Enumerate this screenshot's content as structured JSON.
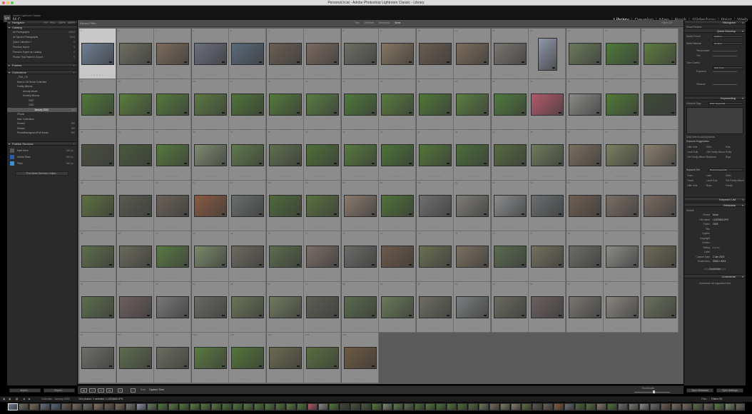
{
  "window": {
    "title": "Personal.lrcat - Adobe Photoshop Lightroom Classic - Library"
  },
  "identity": {
    "logo": "Lrc",
    "line1": "Adobe Lightroom Classic",
    "line2": "M C"
  },
  "modules": [
    "Library",
    "Develop",
    "Map",
    "Book",
    "Slideshow",
    "Print",
    "Web"
  ],
  "active_module": "Library",
  "left_panel": {
    "navigator": {
      "label": "Navigator",
      "zoom": [
        "FIT",
        "FILL",
        "100%",
        "400%"
      ]
    },
    "catalog": {
      "label": "Catalog",
      "items": [
        {
          "label": "All Photographs",
          "count": "25264"
        },
        {
          "label": "All Synced Photographs",
          "count": "5183"
        },
        {
          "label": "Quick Collection +",
          "count": "0"
        },
        {
          "label": "Previous Import",
          "count": "5"
        },
        {
          "label": "Previous Export as Catalog",
          "count": "0"
        },
        {
          "label": "Photos That Failed to Export",
          "count": "0"
        }
      ]
    },
    "folders": {
      "label": "Folders"
    },
    "collections": {
      "label": "Collections",
      "items": [
        {
          "label": "_TAG_CS",
          "count": ""
        },
        {
          "label": "Mom & Gill Smart Collection",
          "count": ""
        },
        {
          "label": "Family Albums",
          "count": ""
        },
        {
          "label": "Annual Album",
          "count": ""
        },
        {
          "label": "Monthly Albums",
          "count": ""
        },
        {
          "label": "2022",
          "count": ""
        },
        {
          "label": "2023",
          "count": ""
        },
        {
          "label": "January 2023",
          "count": "104"
        },
        {
          "label": "iPhone",
          "count": ""
        },
        {
          "label": "Misc Collections",
          "count": ""
        },
        {
          "label": "Shared",
          "count": "990"
        },
        {
          "label": "Shares",
          "count": "990"
        },
        {
          "label": "PhotosBackgroundFull Sessio",
          "count": "990"
        }
      ]
    },
    "publish": {
      "label": "Publish Services",
      "items": [
        {
          "label": "Hard Drive",
          "action": "Set Up..."
        },
        {
          "label": "Adobe Stock",
          "action": "Set Up..."
        },
        {
          "label": "Flickr",
          "action": "Set Up..."
        }
      ],
      "find_more": "Find More Services Online..."
    },
    "import_label": "Import...",
    "export_label": "Export..."
  },
  "grid": {
    "filter_title": "Library Filter :",
    "filter_tabs": [
      "Text",
      "Attribute",
      "Metadata",
      "None"
    ],
    "filters_off": "Filters Off",
    "photos": [
      {
        "n": "1",
        "c": "#6f7f95",
        "s": true
      },
      {
        "n": "2",
        "c": "#6e6e62"
      },
      {
        "n": "3",
        "c": "#7d6c5c"
      },
      {
        "n": "4",
        "c": "#6b6f7e"
      },
      {
        "n": "5",
        "c": "#5a6a7a"
      },
      {
        "n": "6",
        "c": "#6a5f55"
      },
      {
        "n": "7",
        "c": "#7a6a60"
      },
      {
        "n": "8",
        "c": "#6e6e66"
      },
      {
        "n": "9",
        "c": "#857560"
      },
      {
        "n": "10",
        "c": "#6a5c50"
      },
      {
        "n": "11",
        "c": "#7c6d5a"
      },
      {
        "n": "12",
        "c": "#7a7570"
      },
      {
        "n": "13",
        "c": "#8f96a8",
        "p": true
      },
      {
        "n": "14",
        "c": "#6a7a5a"
      },
      {
        "n": "15",
        "c": "#4e7a3a"
      },
      {
        "n": "16",
        "c": "#5c7c3e"
      },
      {
        "n": "17",
        "c": "#4f7a38"
      },
      {
        "n": "18",
        "c": "#5a7e3d"
      },
      {
        "n": "19",
        "c": "#557a3c"
      },
      {
        "n": "20",
        "c": "#5a7a40"
      },
      {
        "n": "21",
        "c": "#4c7436"
      },
      {
        "n": "22",
        "c": "#527a3a"
      },
      {
        "n": "23",
        "c": "#587c42"
      },
      {
        "n": "24",
        "c": "#4e7a3a"
      },
      {
        "n": "25",
        "c": "#577b3e"
      },
      {
        "n": "26",
        "c": "#4f7838"
      },
      {
        "n": "27",
        "c": "#5a7e40"
      },
      {
        "n": "28",
        "c": "#4e7a3c"
      },
      {
        "n": "29",
        "c": "#b25a6a"
      },
      {
        "n": "30",
        "c": "#8a8a88"
      },
      {
        "n": "31",
        "c": "#4f7a36"
      },
      {
        "n": "32",
        "c": "#3e4a38"
      },
      {
        "n": "33",
        "c": "#4a5040"
      },
      {
        "n": "34",
        "c": "#4a5a3c"
      },
      {
        "n": "35",
        "c": "#567a3c"
      },
      {
        "n": "36",
        "c": "#7e8a70"
      },
      {
        "n": "37",
        "c": "#5f7a4a"
      },
      {
        "n": "38",
        "c": "#5e6e4c"
      },
      {
        "n": "39",
        "c": "#4e7038"
      },
      {
        "n": "40",
        "c": "#567a3c"
      },
      {
        "n": "41",
        "c": "#4a7436"
      },
      {
        "n": "42",
        "c": "#527638"
      },
      {
        "n": "43",
        "c": "#4b6e3a"
      },
      {
        "n": "44",
        "c": "#566a3e"
      },
      {
        "n": "45",
        "c": "#6e7a5a"
      },
      {
        "n": "46",
        "c": "#7a6e5e"
      },
      {
        "n": "47",
        "c": "#7a8060"
      },
      {
        "n": "48",
        "c": "#8a7f6e"
      },
      {
        "n": "49",
        "c": "#5e7040"
      },
      {
        "n": "50",
        "c": "#5a5a50"
      },
      {
        "n": "51",
        "c": "#6a6258"
      },
      {
        "n": "52",
        "c": "#8a5a40"
      },
      {
        "n": "53",
        "c": "#6a6e6e"
      },
      {
        "n": "54",
        "c": "#4e6a3a"
      },
      {
        "n": "55",
        "c": "#5a7040"
      },
      {
        "n": "56",
        "c": "#8a7a6e"
      },
      {
        "n": "57",
        "c": "#4e7238"
      },
      {
        "n": "58",
        "c": "#707070"
      },
      {
        "n": "59",
        "c": "#7e7c76"
      },
      {
        "n": "60",
        "c": "#8a8c8e"
      },
      {
        "n": "61",
        "c": "#6a6e70"
      },
      {
        "n": "62",
        "c": "#6e5e52"
      },
      {
        "n": "63",
        "c": "#7a6e64"
      },
      {
        "n": "64",
        "c": "#786a60"
      },
      {
        "n": "65",
        "c": "#5e6e4a"
      },
      {
        "n": "66",
        "c": "#6a6a5c"
      },
      {
        "n": "67",
        "c": "#5a7a44"
      },
      {
        "n": "68",
        "c": "#7a8a6a"
      },
      {
        "n": "69",
        "c": "#6e6a60"
      },
      {
        "n": "70",
        "c": "#5c6c4c"
      },
      {
        "n": "71",
        "c": "#7a6e68"
      },
      {
        "n": "72",
        "c": "#6a6c68"
      },
      {
        "n": "73",
        "c": "#6e5a4a"
      },
      {
        "n": "74",
        "c": "#6a7052"
      },
      {
        "n": "75",
        "c": "#7a7060"
      },
      {
        "n": "76",
        "c": "#5a6a50"
      },
      {
        "n": "77",
        "c": "#74705e"
      },
      {
        "n": "78",
        "c": "#6c6c66"
      },
      {
        "n": "79",
        "c": "#8a8a86"
      },
      {
        "n": "80",
        "c": "#6e6a56"
      },
      {
        "n": "81",
        "c": "#5e6e4c"
      },
      {
        "n": "82",
        "c": "#6e6060"
      },
      {
        "n": "83",
        "c": "#7a7878"
      },
      {
        "n": "84",
        "c": "#6a6a64"
      },
      {
        "n": "85",
        "c": "#6a7456"
      },
      {
        "n": "86",
        "c": "#707a5e"
      },
      {
        "n": "87",
        "c": "#5e5e56"
      },
      {
        "n": "88",
        "c": "#5a6a4c"
      },
      {
        "n": "89",
        "c": "#6a7a58"
      },
      {
        "n": "90",
        "c": "#6e6e64"
      },
      {
        "n": "91",
        "c": "#7a7e7e"
      },
      {
        "n": "92",
        "c": "#6a6a60"
      },
      {
        "n": "93",
        "c": "#6a6060"
      },
      {
        "n": "94",
        "c": "#7a7670"
      },
      {
        "n": "95",
        "c": "#8a8680"
      },
      {
        "n": "96",
        "c": "#6a705c"
      },
      {
        "n": "97",
        "c": "#6e6e6a"
      },
      {
        "n": "98",
        "c": "#5e6c4e"
      },
      {
        "n": "99",
        "c": "#6a6e60"
      },
      {
        "n": "100",
        "c": "#5a7a40"
      },
      {
        "n": "101",
        "c": "#527638"
      },
      {
        "n": "102",
        "c": "#6a6a50"
      },
      {
        "n": "103",
        "c": "#5a6e3e"
      },
      {
        "n": "104",
        "c": "#6e5a40"
      }
    ]
  },
  "toolbar": {
    "sort_label": "Sort:",
    "sort_value": "Capture Time",
    "thumbnails_label": "Thumbnails"
  },
  "filmstrip": {
    "source": "Collection : January 2023",
    "count_text": "104 photos / 1 selected / L1003663.JPG",
    "filter_label": "Filter :",
    "filter_value": "Filters Off"
  },
  "right_panel": {
    "histogram": {
      "label": "Histogram",
      "status": "Smart Preview"
    },
    "quick_develop": {
      "label": "Quick Develop",
      "saved_preset": {
        "label": "Saved Preset",
        "value": "Custom"
      },
      "white_balance": {
        "label": "White Balance",
        "value": "As Shot"
      },
      "temperature": "Temperature",
      "tint": "Tint",
      "tone_control": {
        "label": "Tone Control",
        "value": "Auto Tone"
      },
      "exposure": "Exposure",
      "vibrance": "Vibrance"
    },
    "keywording": {
      "label": "Keywording",
      "keyword_tags_label": "Keyword Tags",
      "keyword_tags_value": "Enter Keywords",
      "click_hint": "Click here to add keywords",
      "suggestions_label": "Keyword Suggestions",
      "suggestions": [
        "Little Kids",
        "Ditch",
        "Kids",
        "Local Kids",
        "Old Family Album",
        "Emily",
        "Old Family Album",
        "Backyard",
        "Boys"
      ],
      "keyword_set_label": "Keyword Set",
      "keyword_set_value": "Recent Keywords",
      "set_items": [
        "Gone",
        "Lake",
        "Ditch",
        "Travel",
        "Local Kids",
        "Old Family Album",
        "Little Kids",
        "Boys",
        "Family"
      ]
    },
    "keyword_list": {
      "label": "Keyword List"
    },
    "metadata": {
      "label": "Metadata",
      "preset_label": "Default",
      "rows": [
        {
          "label": "Preset",
          "value": "None"
        },
        {
          "label": "File Name",
          "value": "L1003663.JPG"
        },
        {
          "label": "Folder",
          "value": "2023"
        },
        {
          "label": "Title",
          "value": ""
        },
        {
          "label": "Caption",
          "value": ""
        },
        {
          "label": "Copyright",
          "value": ""
        },
        {
          "label": "Creator",
          "value": ""
        },
        {
          "label": "Rating",
          "value": "• • • • •"
        },
        {
          "label": "Label",
          "value": ""
        },
        {
          "label": "Capture Date",
          "value": "2 Jan 2023"
        },
        {
          "label": "Dimensions",
          "value": "6048 x 4024"
        }
      ],
      "customize": "Customize"
    },
    "comments": {
      "label": "Comments",
      "note": "Comments not supported here"
    },
    "sync_label": "Sync Metadata",
    "sync_settings_label": "Sync Settings"
  }
}
